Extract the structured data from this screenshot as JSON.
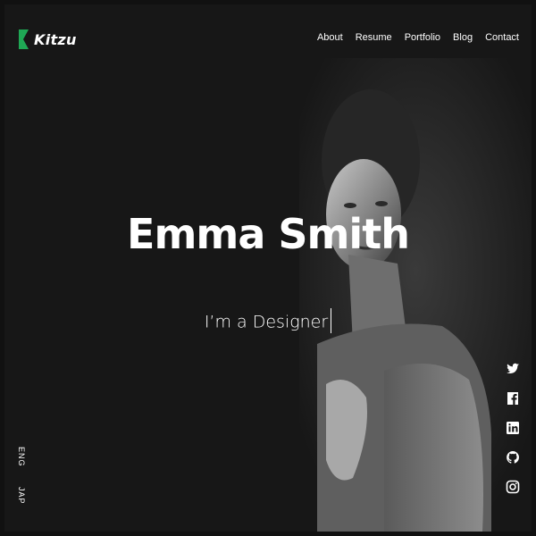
{
  "brand": {
    "name": "Kitzu",
    "accent": "#1fa855"
  },
  "nav": {
    "items": [
      {
        "label": "About"
      },
      {
        "label": "Resume"
      },
      {
        "label": "Portfolio"
      },
      {
        "label": "Blog"
      },
      {
        "label": "Contact"
      }
    ]
  },
  "hero": {
    "name": "Emma Smith",
    "role": "I’m a Designer"
  },
  "languages": [
    "ENG",
    "JAP"
  ],
  "social": [
    "twitter-icon",
    "facebook-icon",
    "linkedin-icon",
    "github-icon",
    "instagram-icon"
  ],
  "colors": {
    "background": "#171717",
    "text": "#ffffff"
  }
}
